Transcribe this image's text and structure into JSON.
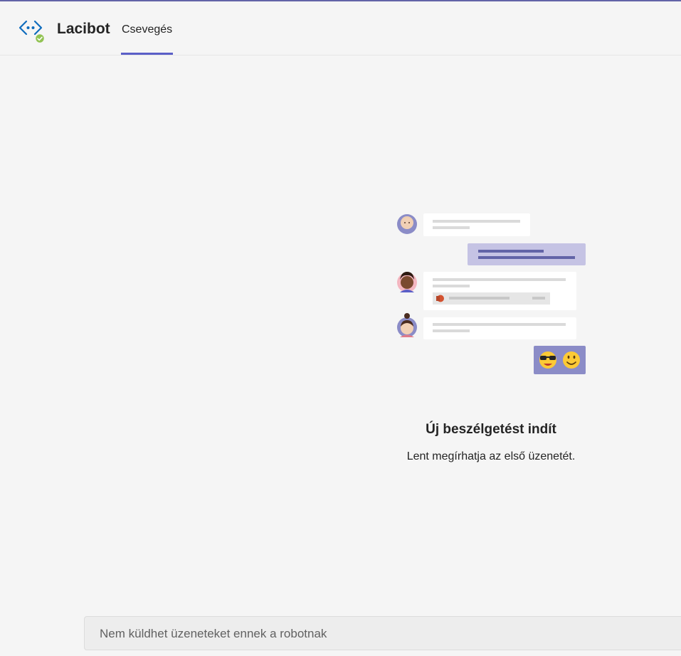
{
  "header": {
    "bot_name": "Lacibot",
    "status": "available",
    "tabs": [
      {
        "label": "Csevegés",
        "selected": true
      }
    ]
  },
  "empty_state": {
    "title": "Új beszélgetést indít",
    "subtitle": "Lent megírhatja az első üzenetét."
  },
  "composer": {
    "placeholder": "Nem küldhet üzeneteket ennek a robotnak"
  },
  "icons": {
    "bot_avatar": "bot-code-icon",
    "status_badge": "available-check-icon"
  },
  "colors": {
    "accent": "#6264a7",
    "tab_underline": "#5b5fc7",
    "status_green": "#92c353",
    "bot_icon_blue": "#0f6cbd"
  }
}
